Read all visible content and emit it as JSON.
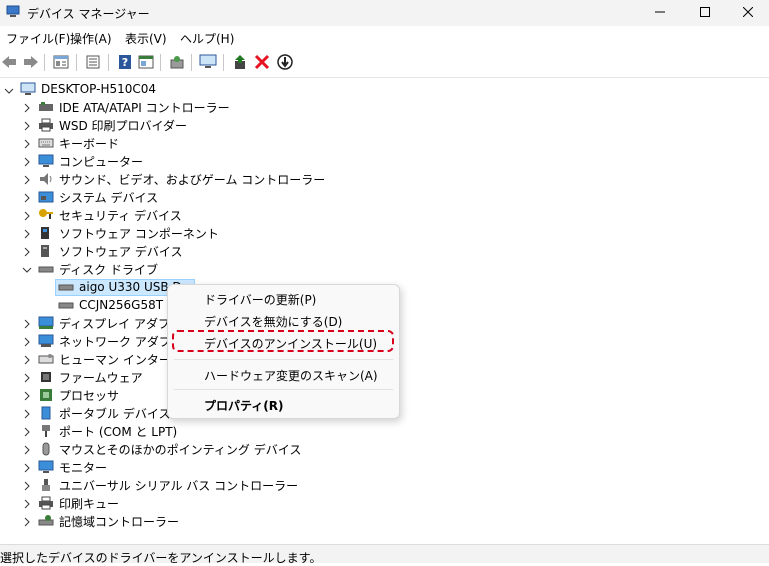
{
  "window": {
    "title": "デバイス マネージャー",
    "controls": {
      "minimize": "—",
      "maximize": "☐",
      "close": "✕"
    }
  },
  "menu": [
    "ファイル(F)",
    "操作(A)",
    "表示(V)",
    "ヘルプ(H)"
  ],
  "toolbar": {
    "icons": [
      "back-icon",
      "forward-icon",
      "properties-icon",
      "list-icon",
      "help-icon",
      "view-icon",
      "scan-icon",
      "monitor-icon",
      "update-driver-icon",
      "uninstall-icon",
      "disable-icon"
    ],
    "colors": {
      "uninstall": "#e81123",
      "update": "#1f7a1f",
      "help": "#2b579a"
    }
  },
  "tree": {
    "root": "DESKTOP-H510C04",
    "items": [
      {
        "label": "IDE ATA/ATAPI コントローラー",
        "icon": "ide-controller-icon"
      },
      {
        "label": "WSD 印刷プロバイダー",
        "icon": "printer-icon"
      },
      {
        "label": "キーボード",
        "icon": "keyboard-icon"
      },
      {
        "label": "コンピューター",
        "icon": "computer-icon"
      },
      {
        "label": "サウンド、ビデオ、およびゲーム コントローラー",
        "icon": "sound-icon"
      },
      {
        "label": "システム デバイス",
        "icon": "system-device-icon"
      },
      {
        "label": "セキュリティ デバイス",
        "icon": "security-key-icon"
      },
      {
        "label": "ソフトウェア コンポーネント",
        "icon": "software-component-icon"
      },
      {
        "label": "ソフトウェア デバイス",
        "icon": "software-device-icon"
      },
      {
        "label": "ディスク ドライブ",
        "icon": "disk-drive-icon",
        "expanded": true,
        "children": [
          {
            "label": "aigo U330 USB D",
            "icon": "drive-icon",
            "selected": true
          },
          {
            "label": "CCJN256G58T",
            "icon": "drive-icon"
          }
        ]
      },
      {
        "label": "ディスプレイ アダプター",
        "icon": "display-adapter-icon"
      },
      {
        "label": "ネットワーク アダプター",
        "icon": "network-adapter-icon"
      },
      {
        "label": "ヒューマン インターフェイ",
        "icon": "hid-icon"
      },
      {
        "label": "ファームウェア",
        "icon": "firmware-icon"
      },
      {
        "label": "プロセッサ",
        "icon": "processor-icon"
      },
      {
        "label": "ポータブル デバイス",
        "icon": "portable-device-icon"
      },
      {
        "label": "ポート (COM と LPT)",
        "icon": "port-icon"
      },
      {
        "label": "マウスとそのほかのポインティング デバイス",
        "icon": "mouse-icon"
      },
      {
        "label": "モニター",
        "icon": "monitor-icon"
      },
      {
        "label": "ユニバーサル シリアル バス コントローラー",
        "icon": "usb-icon"
      },
      {
        "label": "印刷キュー",
        "icon": "print-queue-icon"
      },
      {
        "label": "記憶域コントローラー",
        "icon": "storage-controller-icon"
      }
    ]
  },
  "context_menu": {
    "items": [
      {
        "label": "ドライバーの更新(P)"
      },
      {
        "label": "デバイスを無効にする(D)"
      },
      {
        "label": "デバイスのアンインストール(U)",
        "highlighted": true
      },
      {
        "label": "ハードウェア変更のスキャン(A)"
      },
      {
        "label": "プロパティ(R)",
        "bold": true
      }
    ],
    "highlight_color": "#d9001b"
  },
  "status": "選択したデバイスのドライバーをアンインストールします。"
}
